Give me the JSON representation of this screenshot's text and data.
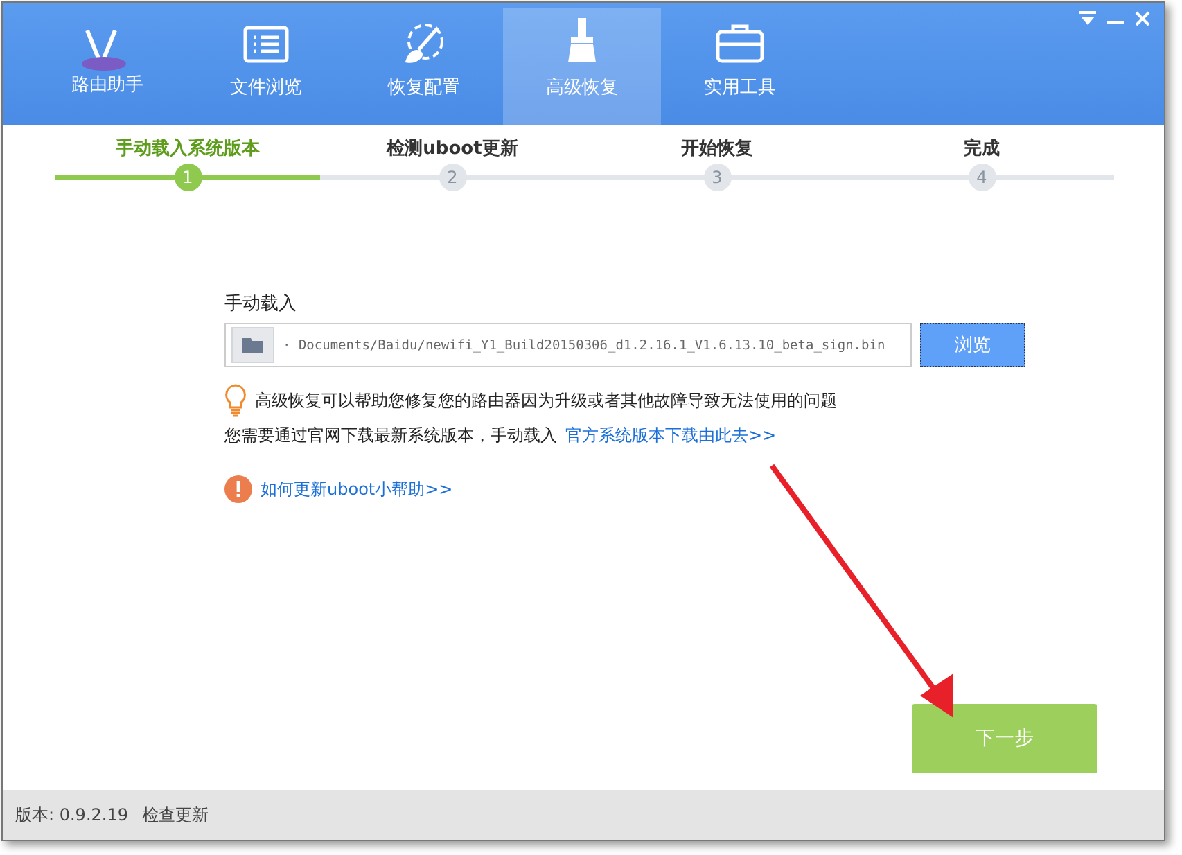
{
  "logo": {
    "text": "路由助手"
  },
  "tabs": [
    {
      "label": "文件浏览",
      "selected": false
    },
    {
      "label": "恢复配置",
      "selected": false
    },
    {
      "label": "高级恢复",
      "selected": true
    },
    {
      "label": "实用工具",
      "selected": false
    }
  ],
  "steps": [
    {
      "label": "手动载入系统版本",
      "number": "1",
      "selected": true
    },
    {
      "label": "检测uboot更新",
      "number": "2",
      "selected": false
    },
    {
      "label": "开始恢复",
      "number": "3",
      "selected": false
    },
    {
      "label": "完成",
      "number": "4",
      "selected": false
    }
  ],
  "load": {
    "label": "手动载入",
    "value": "· Documents/Baidu/newifi_Y1_Build20150306_d1.2.16.1_V1.6.13.10_beta_sign.bin",
    "browse": "浏览"
  },
  "tip": "高级恢复可以帮助您修复您的路由器因为升级或者其他故障导致无法使用的问题",
  "notice": {
    "text": "您需要通过官网下载最新系统版本，手动载入",
    "link": "官方系统版本下载由此去>>"
  },
  "help_link": "如何更新uboot小帮助>>",
  "next_button": "下一步",
  "annotation": {
    "kind": "arrow"
  },
  "status_bar": {
    "version": "版本: 0.9.2.19",
    "check_update": "检查更新"
  }
}
